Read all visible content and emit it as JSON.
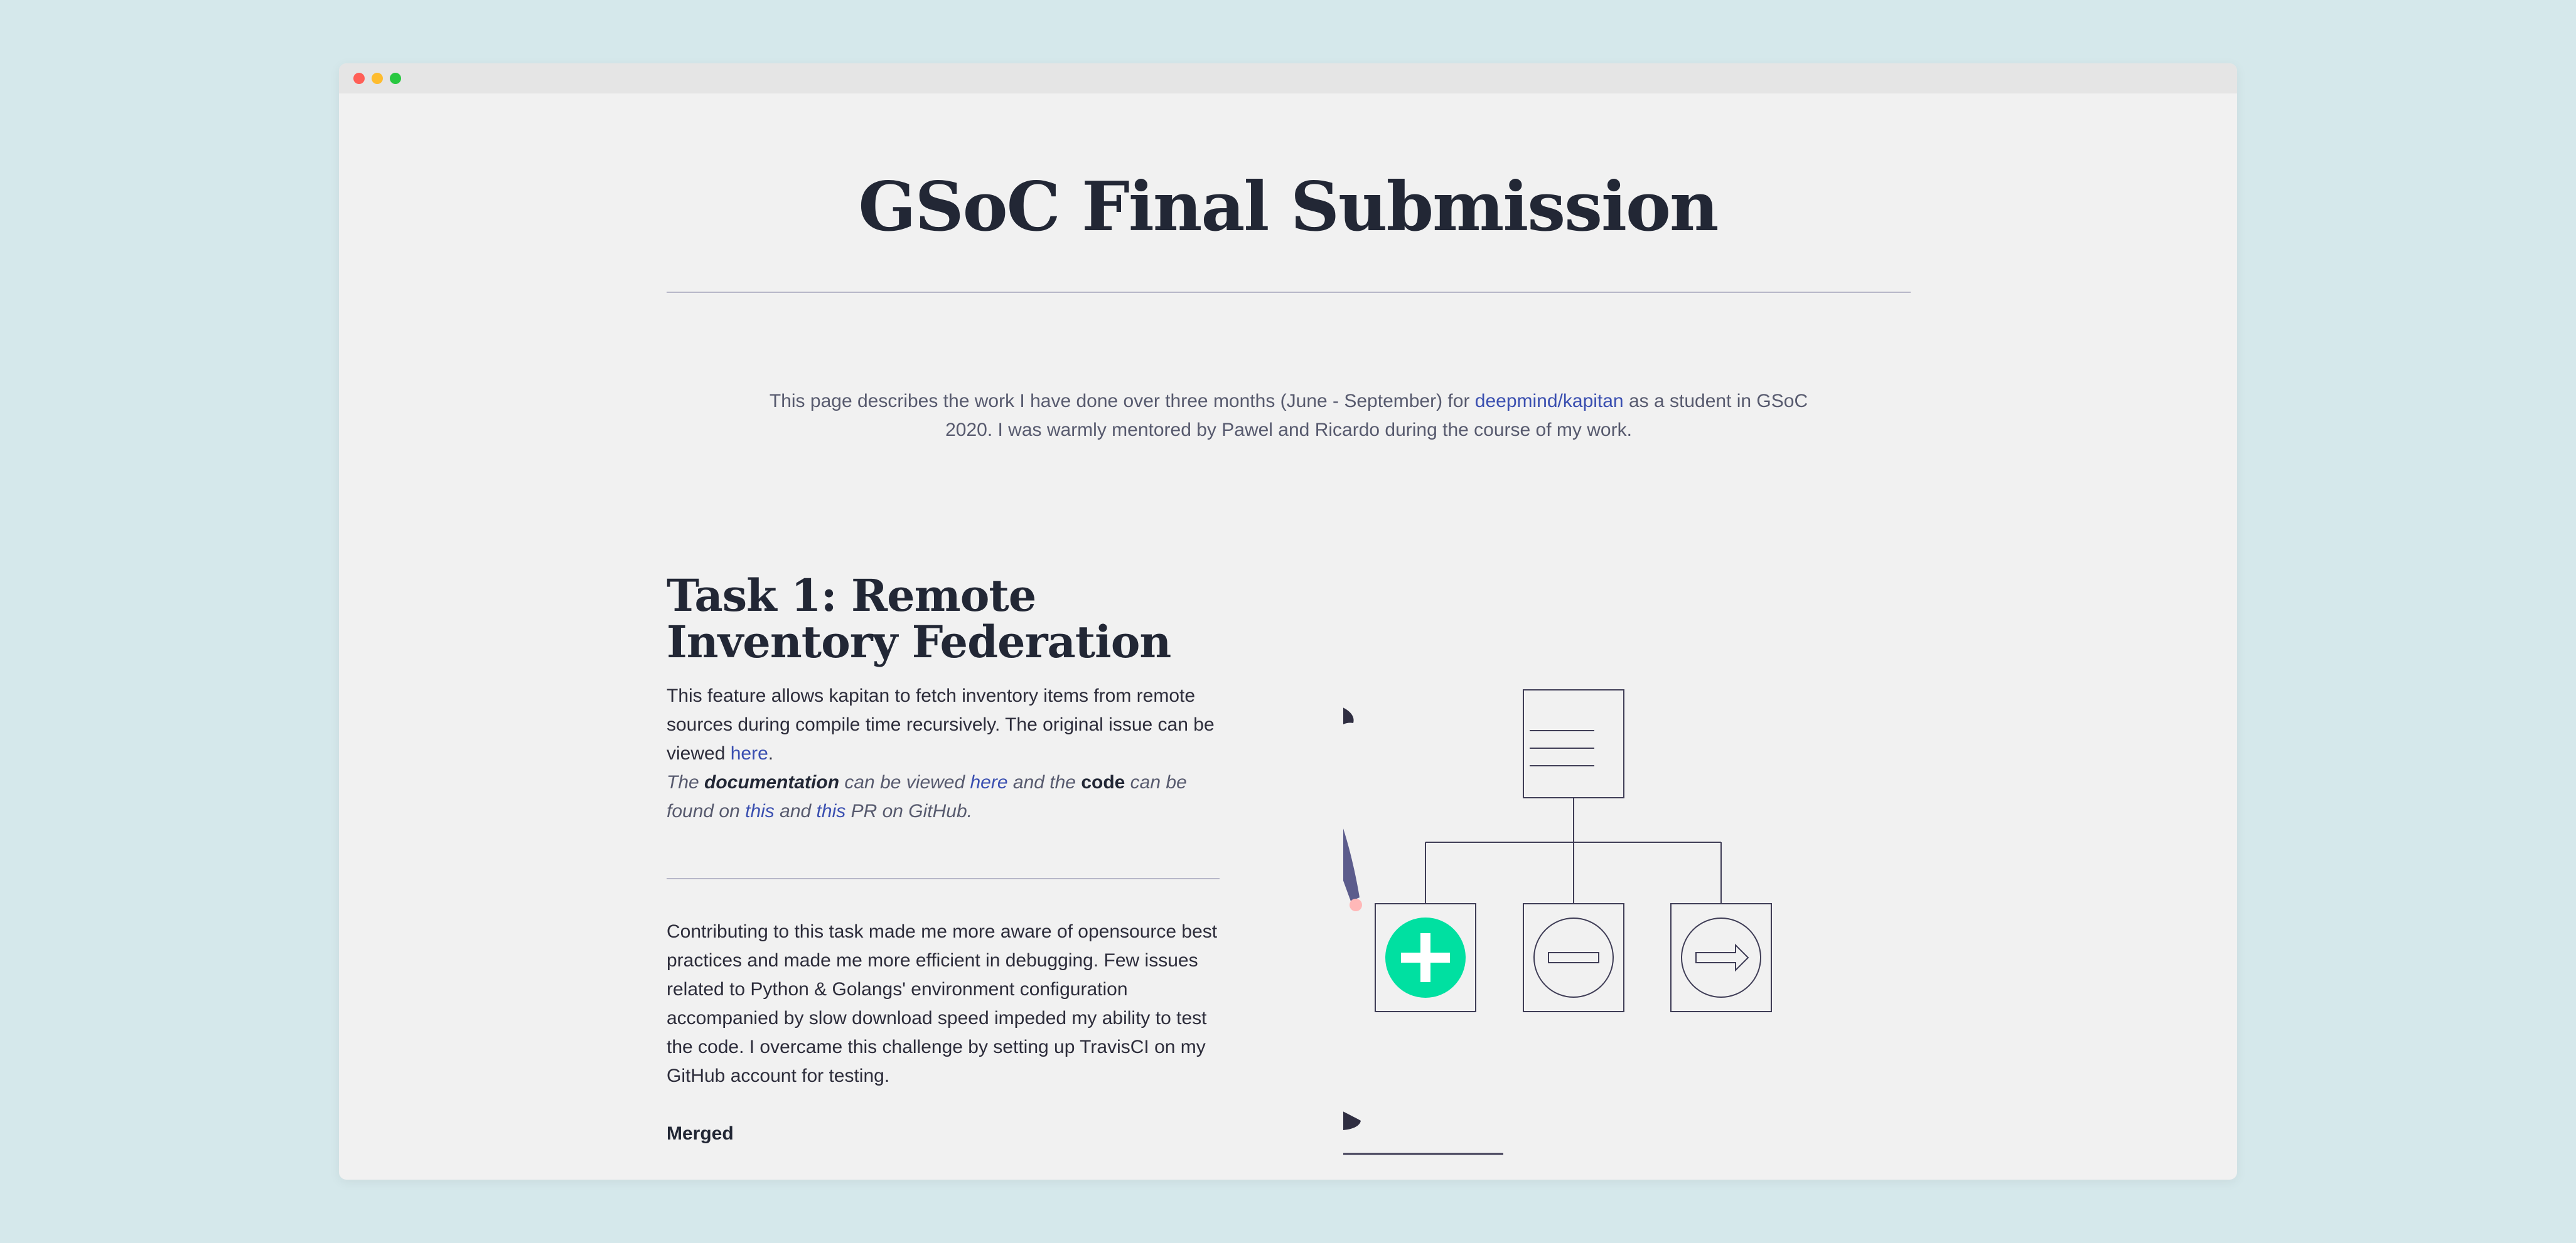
{
  "window": {
    "controls": [
      "close",
      "minimize",
      "maximize"
    ],
    "colors": {
      "close": "#ff5f57",
      "minimize": "#febc2e",
      "maximize": "#28c840"
    }
  },
  "page": {
    "title": "GSoC Final Submission",
    "intro": {
      "before_link": "This page describes the work I have done over three months (June - September) for ",
      "link_text": "deepmind/kapitan",
      "after_link": " as a student in GSoC 2020. I was warmly mentored by Pawel and Ricardo during the course of my work."
    }
  },
  "task1": {
    "heading": "Task 1: Remote Inventory Federation",
    "desc_text": "This feature allows kapitan to fetch inventory items from remote sources during compile time recursively. The original issue can be viewed ",
    "desc_link": "here",
    "desc_end": ".",
    "doc": {
      "p1": "The ",
      "documentation": "documentation",
      "p2": " can be viewed ",
      "here": "here",
      "p3": " and the ",
      "code": "code",
      "p4": " can be found on ",
      "this1": "this",
      "p5": " and ",
      "this2": "this",
      "p6": " PR on GitHub."
    },
    "body": "Contributing to this task made me more aware of opensource best practices and made me more efficient in debugging. Few issues related to Python & Golangs' environment configuration accompanied by slow download speed impeded my ability to test the code. I overcame this challenge by setting up TravisCI on my GitHub account for testing.",
    "status": "Merged"
  },
  "illustration": {
    "icons": [
      "document-icon",
      "plus-icon",
      "minus-icon",
      "arrow-right-icon"
    ],
    "colors": {
      "accent": "#00e0a1",
      "shirt": "#5c5c8c",
      "pants": "#2f2e41",
      "skin": "#ffb8b8",
      "line": "#3f3d56"
    }
  },
  "colors": {
    "background": "#d5e8eb",
    "window": "#f1f1f1",
    "titlebar": "#e5e5e5",
    "link": "#3a4fb0",
    "heading": "#222735"
  }
}
